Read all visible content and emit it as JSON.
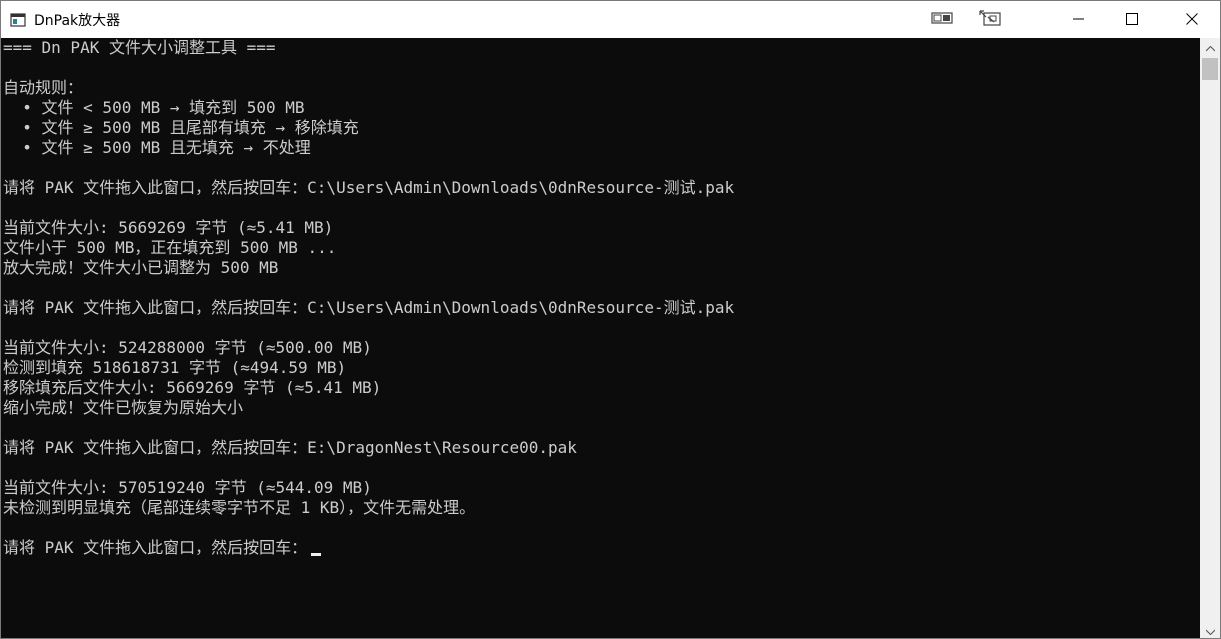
{
  "window": {
    "title": "DnPak放大器",
    "icon": "console-app-icon"
  },
  "titlebar_buttons": {
    "snap1_icon": "window-snap-icon",
    "snap2_icon": "window-layout-icon",
    "minimize_icon": "minimize-icon",
    "maximize_icon": "maximize-icon",
    "close_icon": "close-icon"
  },
  "console": {
    "lines": [
      "=== Dn PAK 文件大小调整工具 ===",
      "",
      "自动规则：",
      "  • 文件 < 500 MB → 填充到 500 MB",
      "  • 文件 ≥ 500 MB 且尾部有填充 → 移除填充",
      "  • 文件 ≥ 500 MB 且无填充 → 不处理",
      "",
      "请将 PAK 文件拖入此窗口，然后按回车：C:\\Users\\Admin\\Downloads\\0dnResource-测试.pak",
      "",
      "当前文件大小: 5669269 字节 (≈5.41 MB)",
      "文件小于 500 MB，正在填充到 500 MB ...",
      "放大完成！文件大小已调整为 500 MB",
      "",
      "请将 PAK 文件拖入此窗口，然后按回车：C:\\Users\\Admin\\Downloads\\0dnResource-测试.pak",
      "",
      "当前文件大小: 524288000 字节 (≈500.00 MB)",
      "检测到填充 518618731 字节 (≈494.59 MB)",
      "移除填充后文件大小: 5669269 字节 (≈5.41 MB)",
      "缩小完成！文件已恢复为原始大小",
      "",
      "请将 PAK 文件拖入此窗口，然后按回车：E:\\DragonNest\\Resource00.pak",
      "",
      "当前文件大小: 570519240 字节 (≈544.09 MB)",
      "未检测到明显填充（尾部连续零字节不足 1 KB），文件无需处理。",
      "",
      "请将 PAK 文件拖入此窗口，然后按回车："
    ]
  },
  "scrollbar": {
    "up_icon": "scroll-up-arrow-icon",
    "down_icon": "scroll-down-arrow-icon",
    "position": 0
  }
}
